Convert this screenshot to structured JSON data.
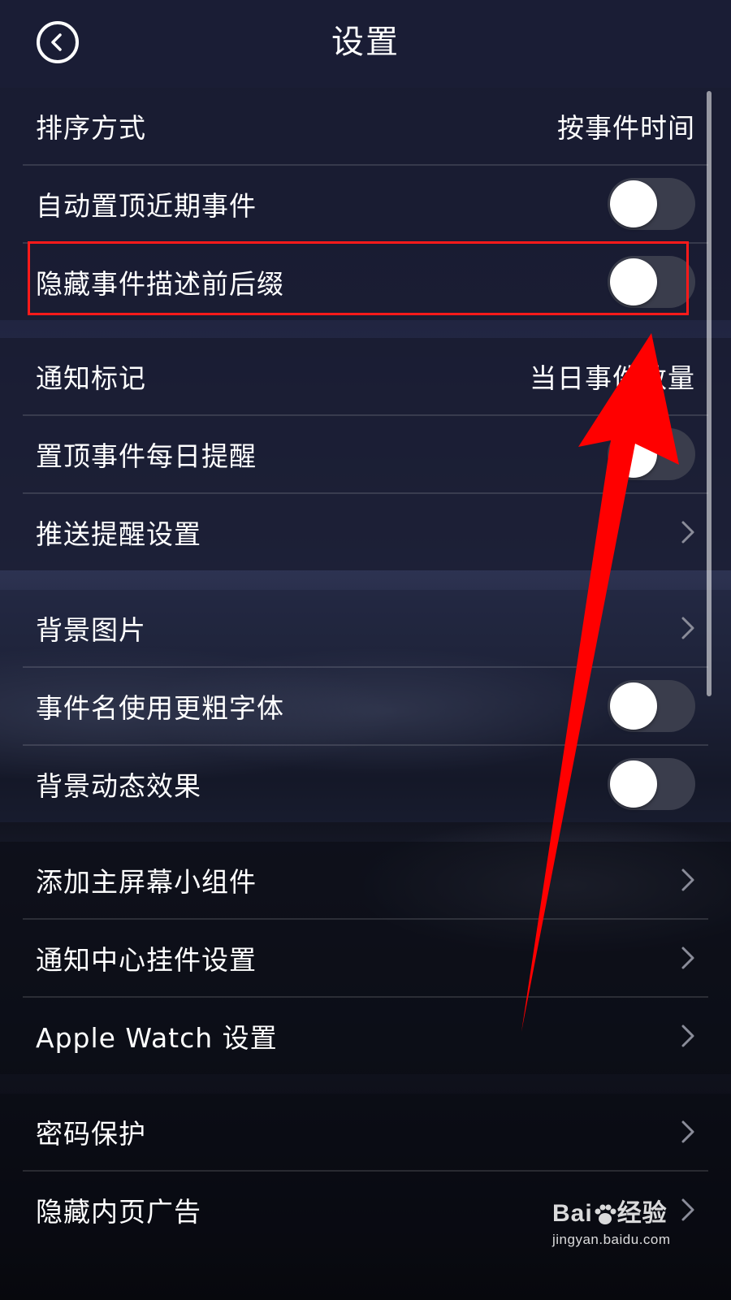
{
  "header": {
    "title": "设置"
  },
  "groups": [
    {
      "rows": [
        {
          "label": "排序方式",
          "value": "按事件时间"
        },
        {
          "label": "自动置顶近期事件",
          "toggle": false
        },
        {
          "label": "隐藏事件描述前后缀",
          "toggle": false
        }
      ]
    },
    {
      "rows": [
        {
          "label": "通知标记",
          "value": "当日事件数量"
        },
        {
          "label": "置顶事件每日提醒",
          "toggle": false
        },
        {
          "label": "推送提醒设置"
        }
      ]
    },
    {
      "rows": [
        {
          "label": "背景图片"
        },
        {
          "label": "事件名使用更粗字体",
          "toggle": false
        },
        {
          "label": "背景动态效果",
          "toggle": false
        }
      ]
    },
    {
      "rows": [
        {
          "label": "添加主屏幕小组件"
        },
        {
          "label": "通知中心挂件设置"
        },
        {
          "label": "Apple Watch 设置"
        }
      ]
    },
    {
      "rows": [
        {
          "label": "密码保护"
        },
        {
          "label": "隐藏内页广告"
        }
      ]
    }
  ],
  "annotation": {
    "highlight_color": "#ff1a1a",
    "arrow_color": "#ff0000"
  },
  "watermark": {
    "brand": "Bai",
    "brand_suffix": "经验",
    "url": "jingyan.baidu.com"
  }
}
